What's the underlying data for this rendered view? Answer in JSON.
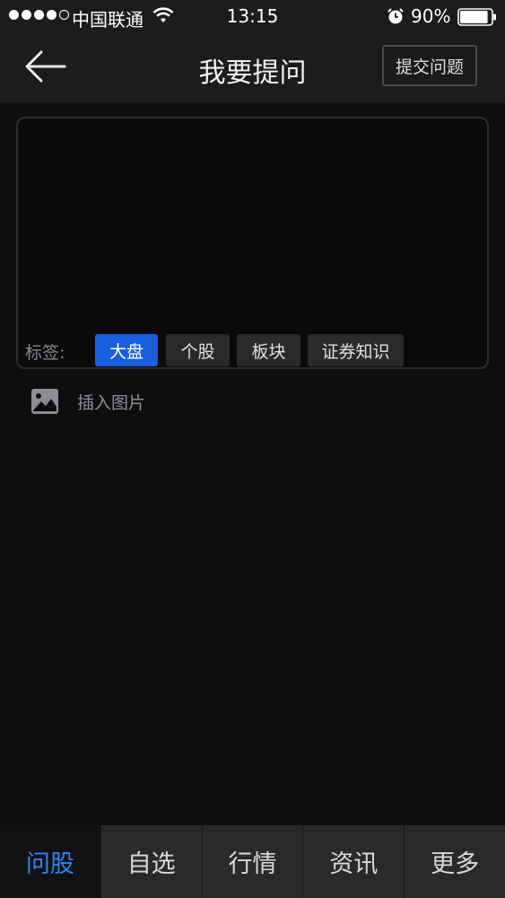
{
  "status_bar": {
    "carrier": "中国联通",
    "time": "13:15",
    "battery_percent": "90%",
    "signal_bars_filled": 4,
    "signal_bars_total": 5,
    "battery_level": 0.9
  },
  "header": {
    "title": "我要提问",
    "back_icon": "arrow-left-icon",
    "submit_label": "提交问题"
  },
  "question": {
    "text": "",
    "tags_label": "标签:",
    "tags": [
      {
        "label": "大盘",
        "selected": true
      },
      {
        "label": "个股",
        "selected": false
      },
      {
        "label": "板块",
        "selected": false
      },
      {
        "label": "证券知识",
        "selected": false
      }
    ]
  },
  "insert_image": {
    "icon": "image-icon",
    "label": "插入图片"
  },
  "tab_bar": {
    "items": [
      {
        "label": "问股",
        "active": true
      },
      {
        "label": "自选",
        "active": false
      },
      {
        "label": "行情",
        "active": false
      },
      {
        "label": "资讯",
        "active": false
      },
      {
        "label": "更多",
        "active": false
      }
    ]
  },
  "colors": {
    "accent": "#2f84f0",
    "tag_selected": "#1a5ee0",
    "background": "#0e0d10",
    "bar_background": "#1c1c1e"
  }
}
